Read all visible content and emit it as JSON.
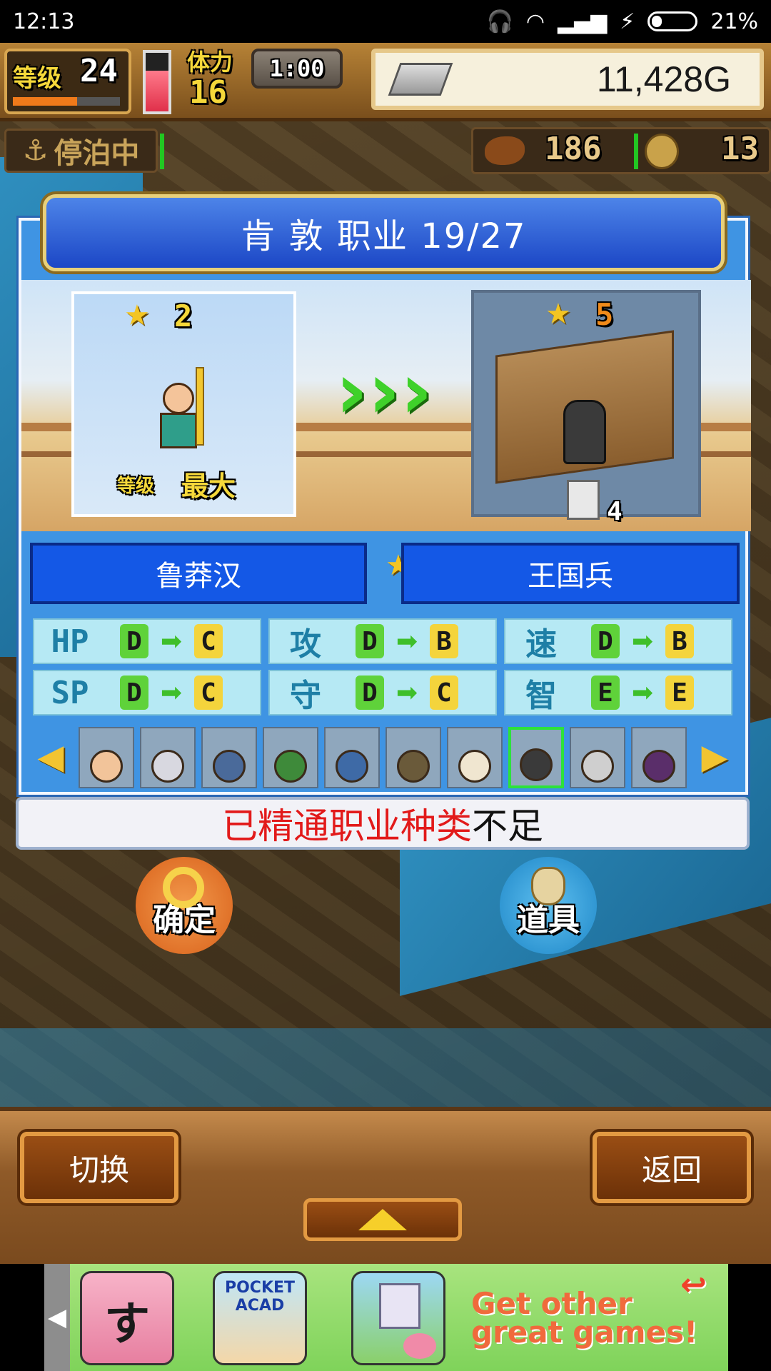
{
  "status_bar": {
    "time": "12:13",
    "battery": "21%"
  },
  "hud": {
    "level_label": "等级",
    "level": "24",
    "stamina_label": "体力",
    "stamina": "16",
    "timer": "1:00",
    "gold": "11,428G",
    "anchor_status": "停泊中",
    "food": "186",
    "medals": "13"
  },
  "job_panel": {
    "title": "肯 敦  职业 19/27",
    "current": {
      "stars": "2",
      "level_label": "等级",
      "level_value": "最大",
      "class": "鲁莽汉"
    },
    "next": {
      "stars": "5",
      "item_count": "4",
      "class": "王国兵"
    },
    "stats": [
      {
        "label": "HP",
        "from": "D",
        "to": "C"
      },
      {
        "label": "攻",
        "from": "D",
        "to": "B"
      },
      {
        "label": "速",
        "from": "D",
        "to": "B"
      },
      {
        "label": "SP",
        "from": "D",
        "to": "C"
      },
      {
        "label": "守",
        "from": "D",
        "to": "C"
      },
      {
        "label": "智",
        "from": "E",
        "to": "E"
      }
    ],
    "portraits_selected_index": 7
  },
  "message": {
    "highlight": "已精通职业种类",
    "rest": "不足"
  },
  "actions": {
    "confirm": "确定",
    "items": "道具"
  },
  "bottom_bar": {
    "switch": "切换",
    "back": "返回"
  },
  "ad": {
    "game1": "すし",
    "game2": "POCKET ACAD",
    "cta_line1": "Get other",
    "cta_line2": "great games!"
  },
  "colors": {
    "panel_blue": "#3f94e3",
    "class_box": "#1458e6",
    "grade_from": "#5fd23a",
    "grade_to": "#f4d43c",
    "message_red": "#e21a1a"
  }
}
